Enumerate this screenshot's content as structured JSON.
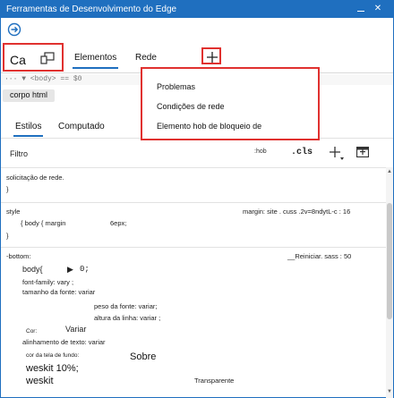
{
  "window": {
    "title": "Ferramentas de Desenvolvimento do Edge",
    "minimize_icon": "minimize-icon",
    "close_label": "✕"
  },
  "nav": {
    "back_icon": "arrow-right-circle-icon"
  },
  "tabs": {
    "ca_label": "Ca",
    "device_icon": "device-emulation-icon",
    "elementos": "Elementos",
    "rede": "Rede",
    "add_icon": "plus-icon"
  },
  "dom": {
    "breadcrumb_text": "··· ▼ <body> == $0",
    "corpo_chip": "corpo html"
  },
  "dropdown": {
    "items": [
      "Problemas",
      "Condições de rede",
      "Elemento hob de bloqueio de"
    ]
  },
  "style_tabs": {
    "estilos": "Estilos",
    "computado": "Computado"
  },
  "filter": {
    "label": "Filtro",
    "hov": ":hob",
    "cls": ".cls",
    "plus_icon": "new-style-rule-icon",
    "sidebar_icon": "toggle-sidebar-icon"
  },
  "rules": {
    "r1": {
      "line1": "solicitação de rede.",
      "close": "}"
    },
    "r2": {
      "selector": "style",
      "source": "margin: site . cuss .2v=8ndytL-c : 16",
      "body_line": "{ body { margin",
      "body_value": "6epx;",
      "close": "}"
    },
    "r3": {
      "selector": "-bottom:",
      "source": "__Reiniciar. sass : 50",
      "body_sel": "body{",
      "body_arrow": "▶",
      "body_val": "0;",
      "font_family": "font-family: vary ;",
      "font_size": "tamanho da fonte: variar",
      "font_weight": "peso da fonte: variar;",
      "line_height": "altura da linha: variar ;",
      "cor_label": "Cor:",
      "cor_value": "Variar",
      "text_align": "alinhamento de texto: variar",
      "bg_label": "cor da tela de fundo:",
      "sobre": "Sobre",
      "weskit1": "weskit 10%;",
      "weskit2": "weskit",
      "transparente": "Transparente"
    }
  }
}
